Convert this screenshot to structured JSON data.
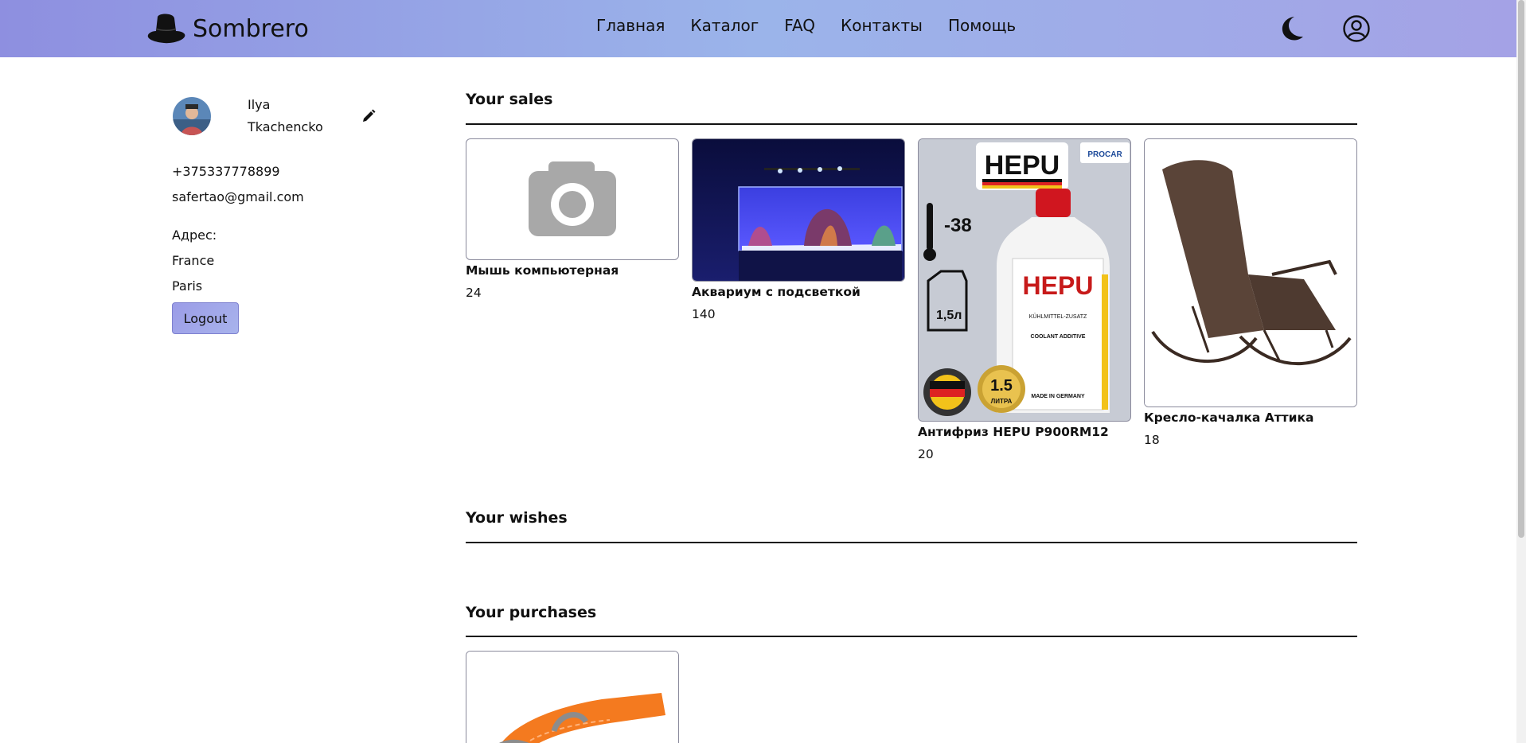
{
  "header": {
    "brand": "Sombrero",
    "nav": [
      {
        "label": "Главная"
      },
      {
        "label": "Каталог"
      },
      {
        "label": "FAQ"
      },
      {
        "label": "Контакты"
      },
      {
        "label": "Помощь"
      }
    ]
  },
  "profile": {
    "first_name": "Ilya",
    "last_name": "Tkachencko",
    "phone": "+375337778899",
    "email": "safertao@gmail.com",
    "address_label": "Адрес:",
    "country": "France",
    "city": "Paris",
    "logout_label": "Logout"
  },
  "sales": {
    "title": "Your sales",
    "items": [
      {
        "name": "Мышь компьютерная",
        "price": "24"
      },
      {
        "name": "Аквариум с подсветкой",
        "price": "140"
      },
      {
        "name": "Антифриз HEPU P900RM12",
        "price": "20"
      },
      {
        "name": "Кресло-качалка Аттика",
        "price": "18"
      }
    ],
    "hepu_image_text": {
      "brand": "HEPU",
      "badge": "PROCAR",
      "temp": "-38",
      "volume": "1,5л",
      "bottle_line1": "KÜHLMITTEL-ZUSATZ",
      "bottle_line2": "COOLANT ADDITIVE",
      "bottle_line3": "MADE IN GERMANY",
      "liters": "1.5",
      "liters_word": "ЛИТРА"
    }
  },
  "wishes": {
    "title": "Your wishes"
  },
  "purchases": {
    "title": "Your purchases"
  },
  "colors": {
    "header_gradient_start": "#8e8fe0",
    "header_gradient_end": "#a4a2e6",
    "accent": "#9b9ce7"
  }
}
